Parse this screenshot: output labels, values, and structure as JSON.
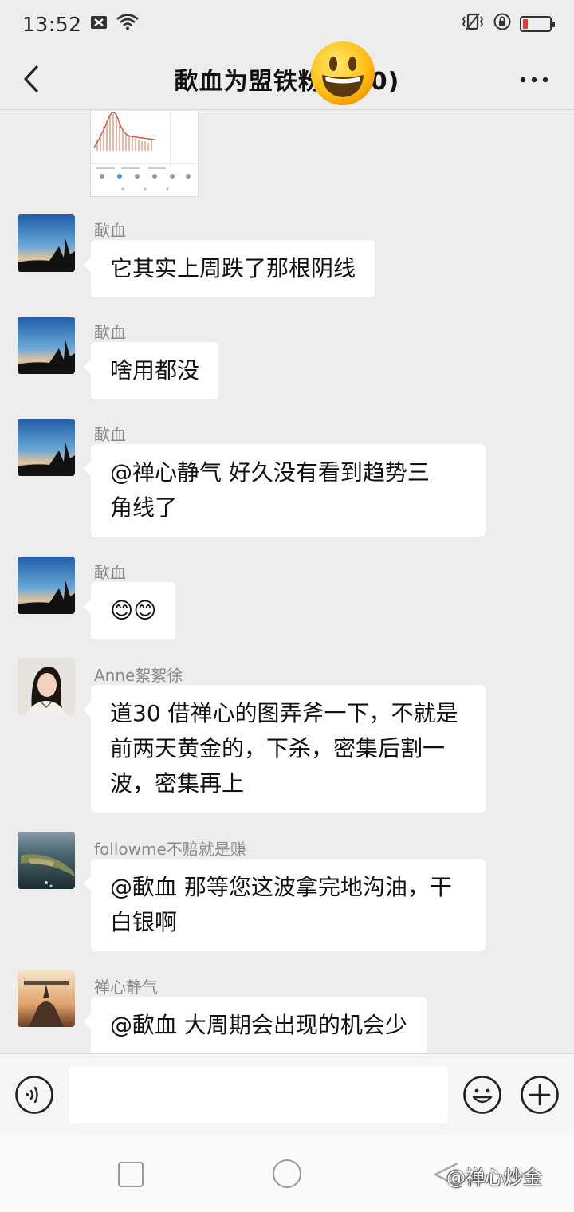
{
  "status_bar": {
    "time": "13:52"
  },
  "header": {
    "title_visible": "歃血为盟铁粉",
    "title_suffix": "0)",
    "back_icon": "chevron-left-icon",
    "more_icon": "more-dots-icon"
  },
  "messages": [
    {
      "sender": "歃血",
      "lines": [
        "它其实上周跌了那根阴线"
      ]
    },
    {
      "sender": "歃血",
      "lines": [
        "啥用都没"
      ]
    },
    {
      "sender": "歃血",
      "lines": [
        "@禅心静气   好久没有看到趋势三",
        "角线了"
      ]
    },
    {
      "sender": "歃血",
      "lines": [
        "😊😊"
      ]
    },
    {
      "sender": "Anne絮絮徐",
      "lines": [
        "道30 借禅心的图弄斧一下，不就是",
        "前两天黄金的，下杀，密集后割一",
        "波，密集再上"
      ]
    },
    {
      "sender": "followme不赔就是赚",
      "lines": [
        "@歃血  那等您这波拿完地沟油，干",
        "白银啊"
      ]
    },
    {
      "sender": "禅心静气",
      "lines": [
        "@歃血  大周期会出现的机会少"
      ]
    }
  ],
  "input_bar": {
    "placeholder": "",
    "voice_icon": "voice-icon",
    "emoji_icon": "emoji-icon",
    "plus_icon": "plus-icon"
  },
  "watermark": "@禅心炒金"
}
